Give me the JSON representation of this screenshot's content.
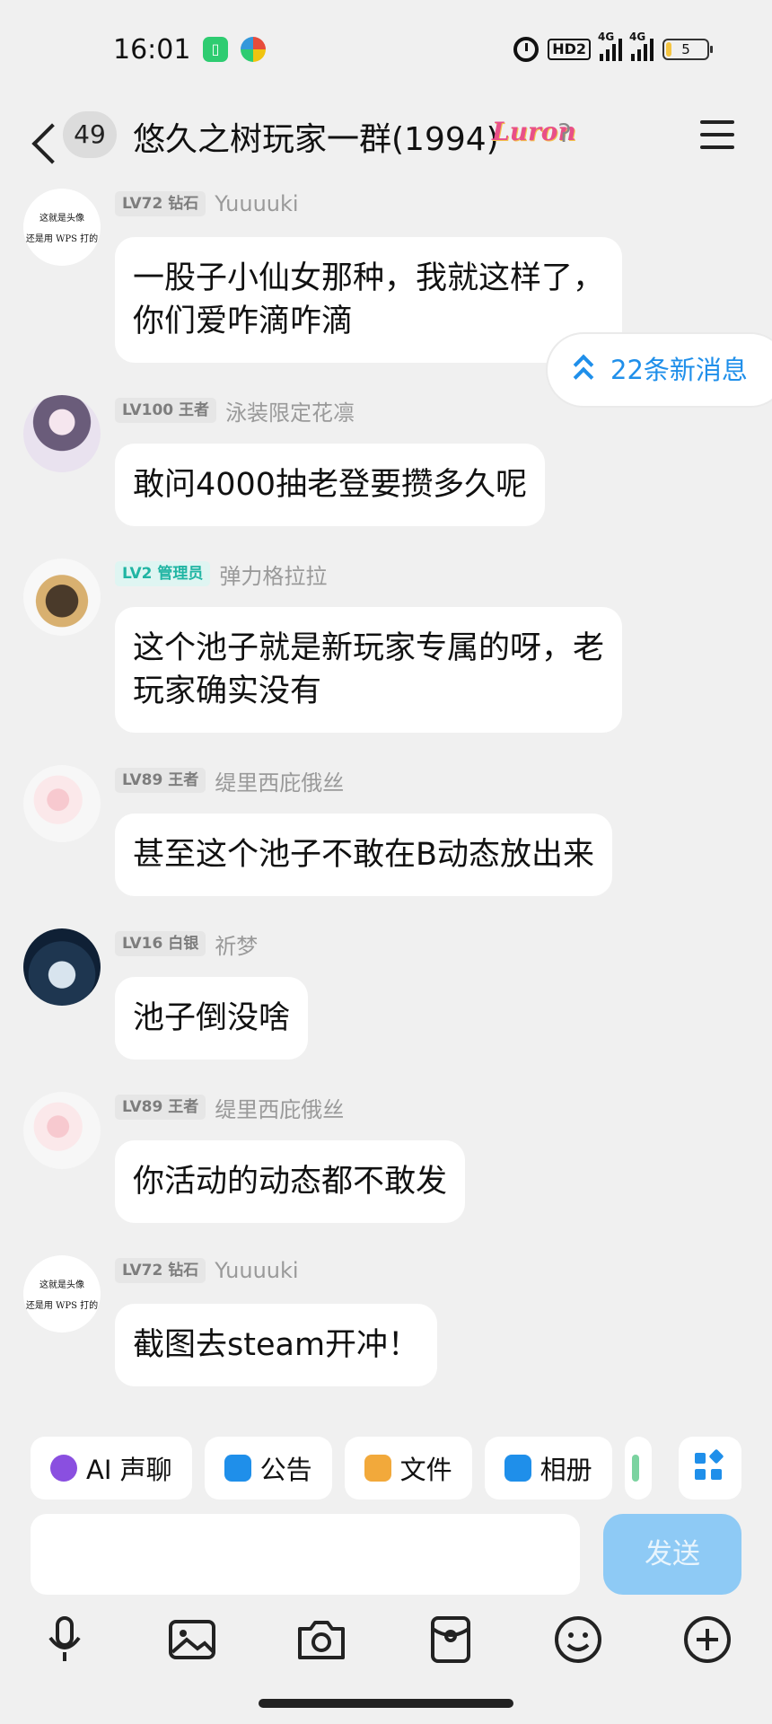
{
  "status_bar": {
    "time": "16:01",
    "hd_label": "HD2",
    "network_1": "4G",
    "network_2": "4G",
    "battery": "5"
  },
  "header": {
    "unread_count": "49",
    "title": "悠久之树玩家一群(1994)",
    "badge_text": "Luron"
  },
  "new_messages": "22条新消息",
  "avatar_text": {
    "line1": "这就是头像",
    "line2": "还是用 WPS 打的"
  },
  "messages": [
    {
      "level": "LV72 钻石",
      "name": "Yuuuuki",
      "text_lines": [
        "一股子小仙女那种，我就这样了，",
        "你们爱咋滴咋滴"
      ]
    },
    {
      "level": "LV100 王者",
      "name": "泳装限定花凛",
      "text_lines": [
        "敢问4000抽老登要攒多久呢"
      ]
    },
    {
      "level": "LV2 管理员",
      "name": "弹力格拉拉",
      "text_lines": [
        "这个池子就是新玩家专属的呀，老",
        "玩家确实没有"
      ]
    },
    {
      "level": "LV89 王者",
      "name": "缇里西庇俄丝",
      "text_lines": [
        "甚至这个池子不敢在B动态放出来"
      ]
    },
    {
      "level": "LV16 白银",
      "name": "祈梦",
      "text_lines": [
        "池子倒没啥"
      ]
    },
    {
      "level": "LV89 王者",
      "name": "缇里西庇俄丝",
      "text_lines": [
        "你活动的动态都不敢发"
      ]
    },
    {
      "level": "LV72 钻石",
      "name": "Yuuuuki",
      "text_lines": [
        "截图去steam开冲！"
      ]
    }
  ],
  "quick_actions": [
    {
      "label": "AI 声聊",
      "icon": "ai-voice-icon",
      "color": "#8a4fe0"
    },
    {
      "label": "公告",
      "icon": "announcement-icon",
      "color": "#1f8fea"
    },
    {
      "label": "文件",
      "icon": "folder-icon",
      "color": "#f2a93b"
    },
    {
      "label": "相册",
      "icon": "album-icon",
      "color": "#1f8fea"
    }
  ],
  "input": {
    "placeholder": "",
    "send_label": "发送"
  },
  "toolbar_icons": [
    "microphone-icon",
    "image-icon",
    "camera-icon",
    "red-packet-icon",
    "emoji-icon",
    "plus-icon"
  ],
  "colors": {
    "accent": "#1f8fea",
    "send_disabled": "#8ecaf5",
    "admin_badge": "#20b5a3"
  }
}
